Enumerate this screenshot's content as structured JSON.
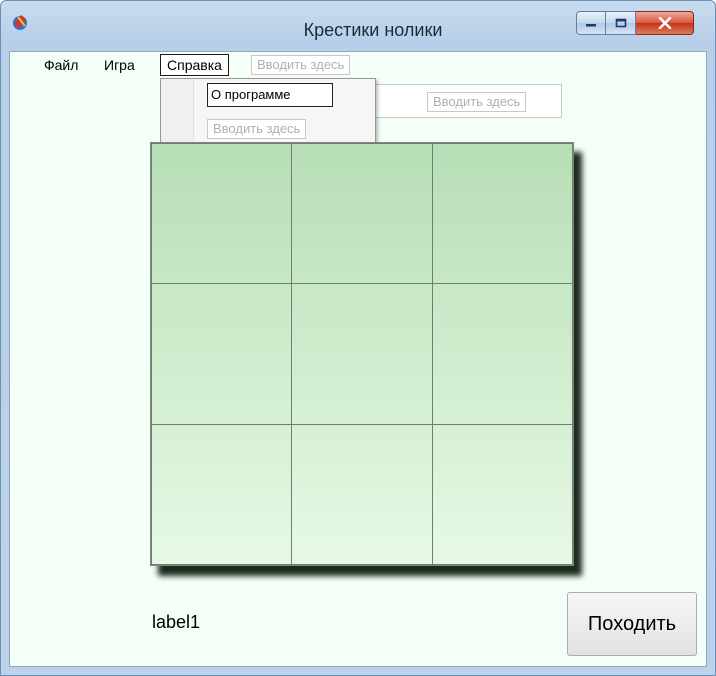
{
  "window": {
    "title": "Крестики нолики"
  },
  "menubar": {
    "items": [
      {
        "label": "Файл"
      },
      {
        "label": "Игра"
      },
      {
        "label": "Справка"
      }
    ],
    "type_here": "Вводить здесь"
  },
  "help_menu": {
    "about": "О программе",
    "type_here": "Вводить здесь",
    "submenu_type_here": "Вводить здесь"
  },
  "board": {
    "rows": 3,
    "cols": 3,
    "cells": [
      "",
      "",
      "",
      "",
      "",
      "",
      "",
      "",
      ""
    ]
  },
  "status": {
    "label": "label1"
  },
  "actions": {
    "move_button": "Походить"
  },
  "colors": {
    "board_top": "#b7deb6",
    "board_bottom": "#e6f9e4",
    "client_bg": "#f3fff7"
  }
}
